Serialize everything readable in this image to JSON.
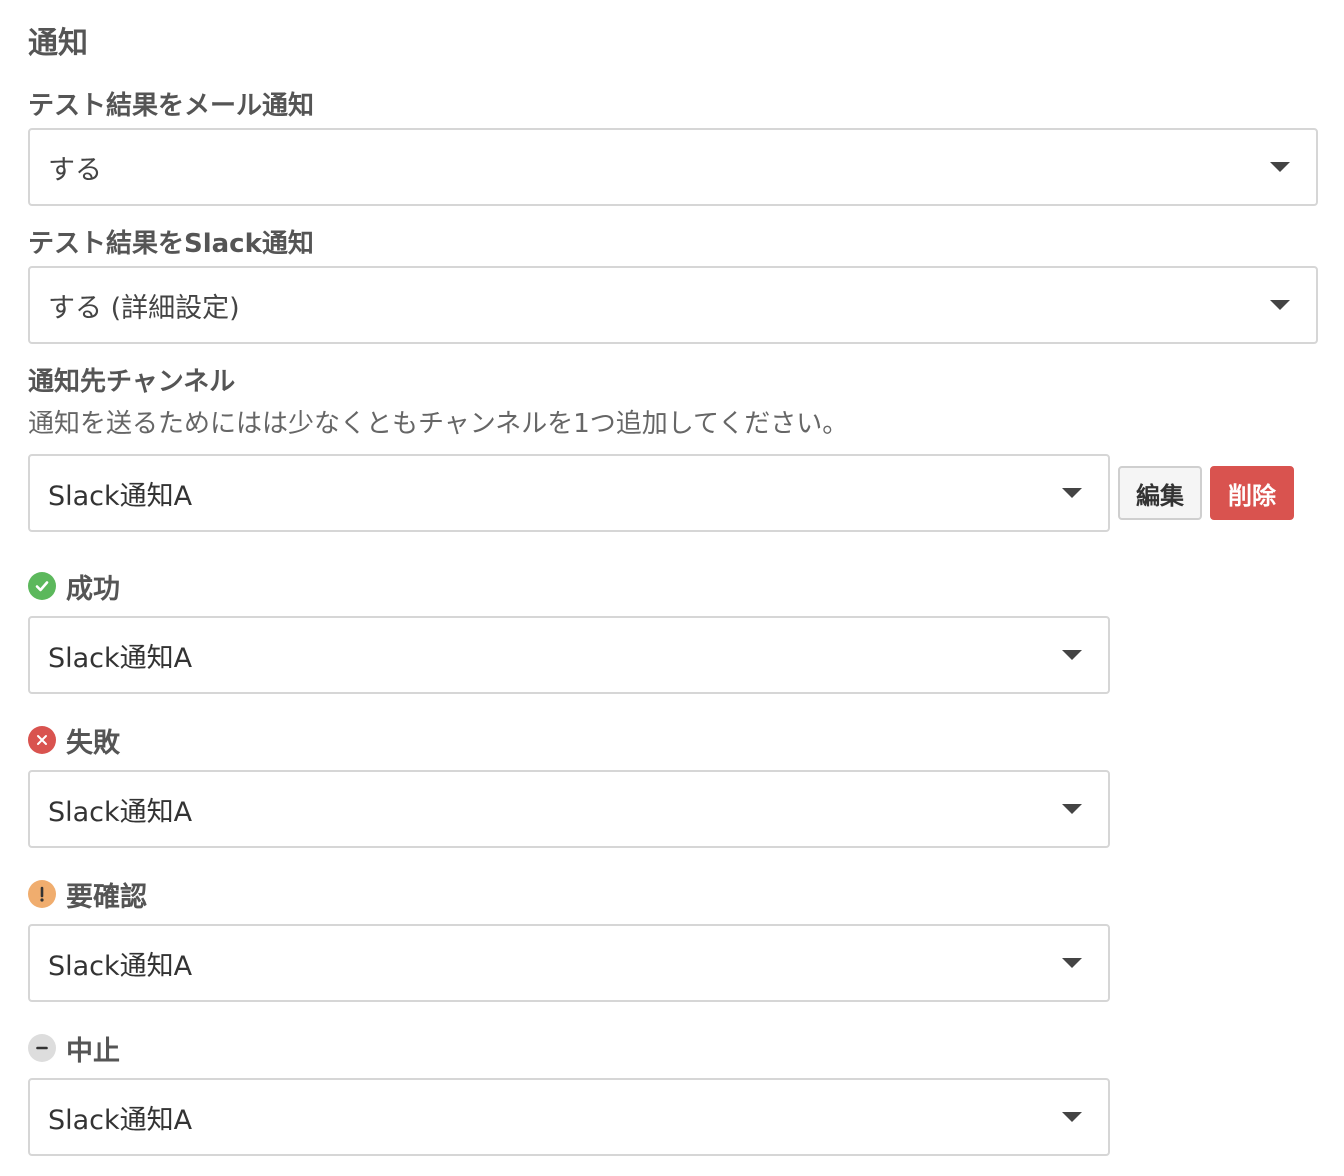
{
  "section": {
    "title": "通知"
  },
  "email_notify": {
    "label": "テスト結果をメール通知",
    "value": "する"
  },
  "slack_notify": {
    "label": "テスト結果をSlack通知",
    "value": "する (詳細設定)"
  },
  "channel": {
    "label": "通知先チャンネル",
    "help": "通知を送るためにはは少なくともチャンネルを1つ追加してください。",
    "value": "Slack通知A",
    "edit_label": "編集",
    "delete_label": "削除"
  },
  "statuses": [
    {
      "label": "成功",
      "icon": "check-circle-icon",
      "color": "#5cb85c",
      "value": "Slack通知A"
    },
    {
      "label": "失敗",
      "icon": "x-circle-icon",
      "color": "#d9534f",
      "value": "Slack通知A"
    },
    {
      "label": "要確認",
      "icon": "exclamation-circle-icon",
      "color": "#f0ad6e",
      "value": "Slack通知A"
    },
    {
      "label": "中止",
      "icon": "minus-circle-icon",
      "color": "#dddddd",
      "value": "Slack通知A"
    }
  ],
  "colors": {
    "danger": "#d9534f",
    "border": "#d6d6d6",
    "text": "#555555"
  }
}
